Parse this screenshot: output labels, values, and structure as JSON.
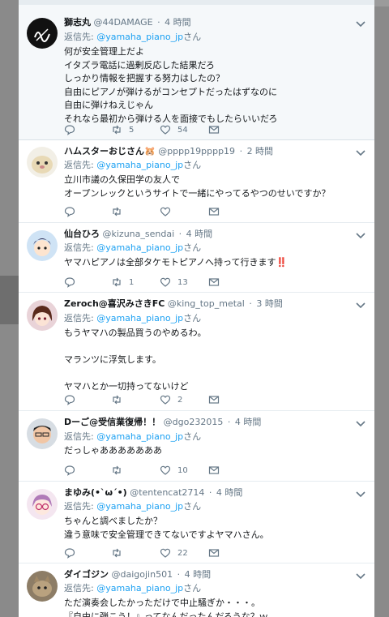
{
  "reply_prefix": "返信先:",
  "reply_suffix": "さん",
  "tweets": [
    {
      "name": "獅志丸",
      "handle": "@44DAMAGE",
      "time": "4 時間",
      "reply_mention": "@yamaha_piano_jp",
      "text": "何が安全管理上だよ\nイタズラ電話に過剰反応した結果だろ\nしっかり情報を把握する努力はしたの？\n自由にピアノが弾けるがコンセプトだったはずなのに\n自由に弾けねえじゃん\nそれなら最初から弾ける人を面接でもしたらいいだろ",
      "counts": {
        "retweets": "5",
        "likes": "54"
      }
    },
    {
      "name": "ハムスターおじさん🐹",
      "handle": "@pppp19pppp19",
      "time": "2 時間",
      "reply_mention": "@yamaha_piano_jp",
      "text": "立川市議の久保田学の友人で\nオープンレックというサイトで一緒にやってるやつのせいですか？",
      "counts": {
        "retweets": "",
        "likes": ""
      }
    },
    {
      "name": "仙台ひろ",
      "handle": "@kizuna_sendai",
      "time": "4 時間",
      "reply_mention": "@yamaha_piano_jp",
      "text": "ヤマハピアノは全部タケモトピアノへ持って行きます‼️",
      "counts": {
        "retweets": "1",
        "likes": "13"
      }
    },
    {
      "name": "Zeroch@喜沢みさきFC",
      "handle": "@king_top_metal",
      "time": "3 時間",
      "reply_mention": "@yamaha_piano_jp",
      "text": "もうヤマハの製品買うのやめるわ。\n\nマランツに浮気します。\n\nヤマハとか一切持ってないけど",
      "counts": {
        "retweets": "",
        "likes": "2"
      }
    },
    {
      "name": "Dーご@受信業復帰！！",
      "handle": "@dgo232015",
      "time": "4 時間",
      "reply_mention": "@yamaha_piano_jp",
      "text": "だっしゃあああああああ",
      "counts": {
        "retweets": "",
        "likes": "10"
      }
    },
    {
      "name": "まゆみ(•`ω´•)",
      "handle": "@tentencat2714",
      "time": "4 時間",
      "reply_mention": "@yamaha_piano_jp",
      "text": "ちゃんと調べましたか？\n違う意味で安全管理できてないですよヤマハさん。",
      "counts": {
        "retweets": "",
        "likes": "22"
      }
    },
    {
      "name": "ダイゴジン",
      "handle": "@daigojin501",
      "time": "4 時間",
      "reply_mention": "@yamaha_piano_jp",
      "text": "ただ演奏会したかっただけで中止騒ぎか・・・。\n『自由に弾こう！』ってなんだったんだろうな？ｗ",
      "counts": {
        "retweets": "",
        "likes": ""
      }
    }
  ],
  "colors": {
    "background_overlay": "#8c8c8c",
    "card": "#ffffff",
    "card_highlighted": "#f5f8fa",
    "mention": "#1da1f2",
    "meta_text": "#657786",
    "body_text": "#14171a",
    "like_red": "#e0245e"
  },
  "icons": [
    "reply-icon",
    "retweet-icon",
    "like-icon",
    "direct-message-icon",
    "chevron-down-icon"
  ]
}
